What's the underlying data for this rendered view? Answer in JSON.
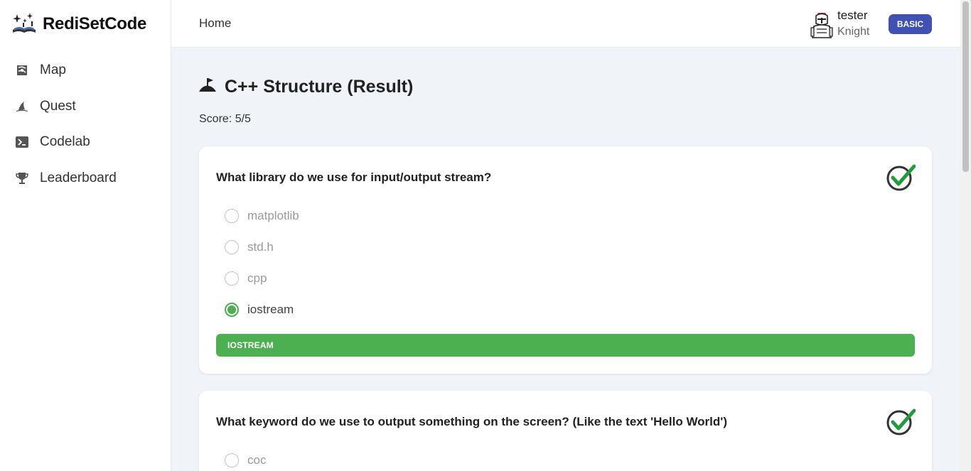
{
  "app": {
    "name": "RediSetCode"
  },
  "sidebar": {
    "items": [
      {
        "label": "Map",
        "icon": "map-icon"
      },
      {
        "label": "Quest",
        "icon": "wizard-hat-icon"
      },
      {
        "label": "Codelab",
        "icon": "terminal-icon"
      },
      {
        "label": "Leaderboard",
        "icon": "trophy-icon"
      }
    ]
  },
  "header": {
    "home_label": "Home",
    "user": {
      "name": "tester",
      "rank": "Knight",
      "avatar": "knight-avatar-icon"
    },
    "badge": "BASIC"
  },
  "page": {
    "title": "C++ Structure (Result)",
    "title_icon": "flag-hill-icon",
    "score": "Score: 5/5"
  },
  "questions": [
    {
      "text": "What library do we use for input/output stream?",
      "correct": true,
      "options": [
        "matplotlib",
        "std.h",
        "cpp",
        "iostream"
      ],
      "selected_index": 3,
      "answer": "IOSTREAM"
    },
    {
      "text": "What keyword do we use to output something on the screen? (Like the text 'Hello World')",
      "correct": true,
      "options": [
        "coc"
      ]
    }
  ],
  "colors": {
    "accent_green": "#4caf50",
    "badge_blue": "#3f51b5",
    "background": "#f0f4f8"
  }
}
